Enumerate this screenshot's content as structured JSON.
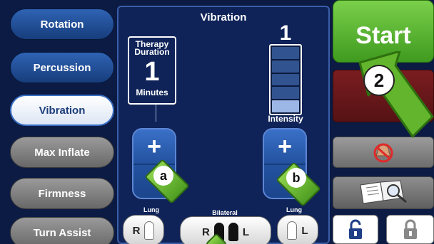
{
  "left_menu": [
    {
      "label": "Rotation",
      "state": "blue"
    },
    {
      "label": "Percussion",
      "state": "blue"
    },
    {
      "label": "Vibration",
      "state": "active"
    },
    {
      "label": "Max Inflate",
      "state": "gray"
    },
    {
      "label": "Firmness",
      "state": "gray"
    },
    {
      "label": "Turn Assist",
      "state": "gray"
    }
  ],
  "panel": {
    "title": "Vibration",
    "duration": {
      "label": "Therapy Duration",
      "value": "1",
      "unit": "Minutes"
    },
    "intensity": {
      "value": "1",
      "label": "Intensity",
      "segments_total": 5,
      "segments_on": 1
    },
    "stepper_plus": "+",
    "lung_selector": {
      "left_label": "Lung",
      "center_label": "Bilateral",
      "right_label": "Lung",
      "left_letter": "R",
      "center_left_letter": "R",
      "center_right_letter": "L",
      "right_letter": "L"
    }
  },
  "callouts": {
    "a": "a",
    "b": "b",
    "step2": "2"
  },
  "right_column": {
    "start_label": "Start",
    "mute_icon": "mute-bell-icon",
    "manual_icon": "manual-search-icon",
    "unlock_icon": "unlock-icon",
    "lock_icon": "lock-icon"
  },
  "colors": {
    "accent_green": "#5fb52f",
    "panel_blue": "#0f2358",
    "stop_red": "#6a181a"
  }
}
